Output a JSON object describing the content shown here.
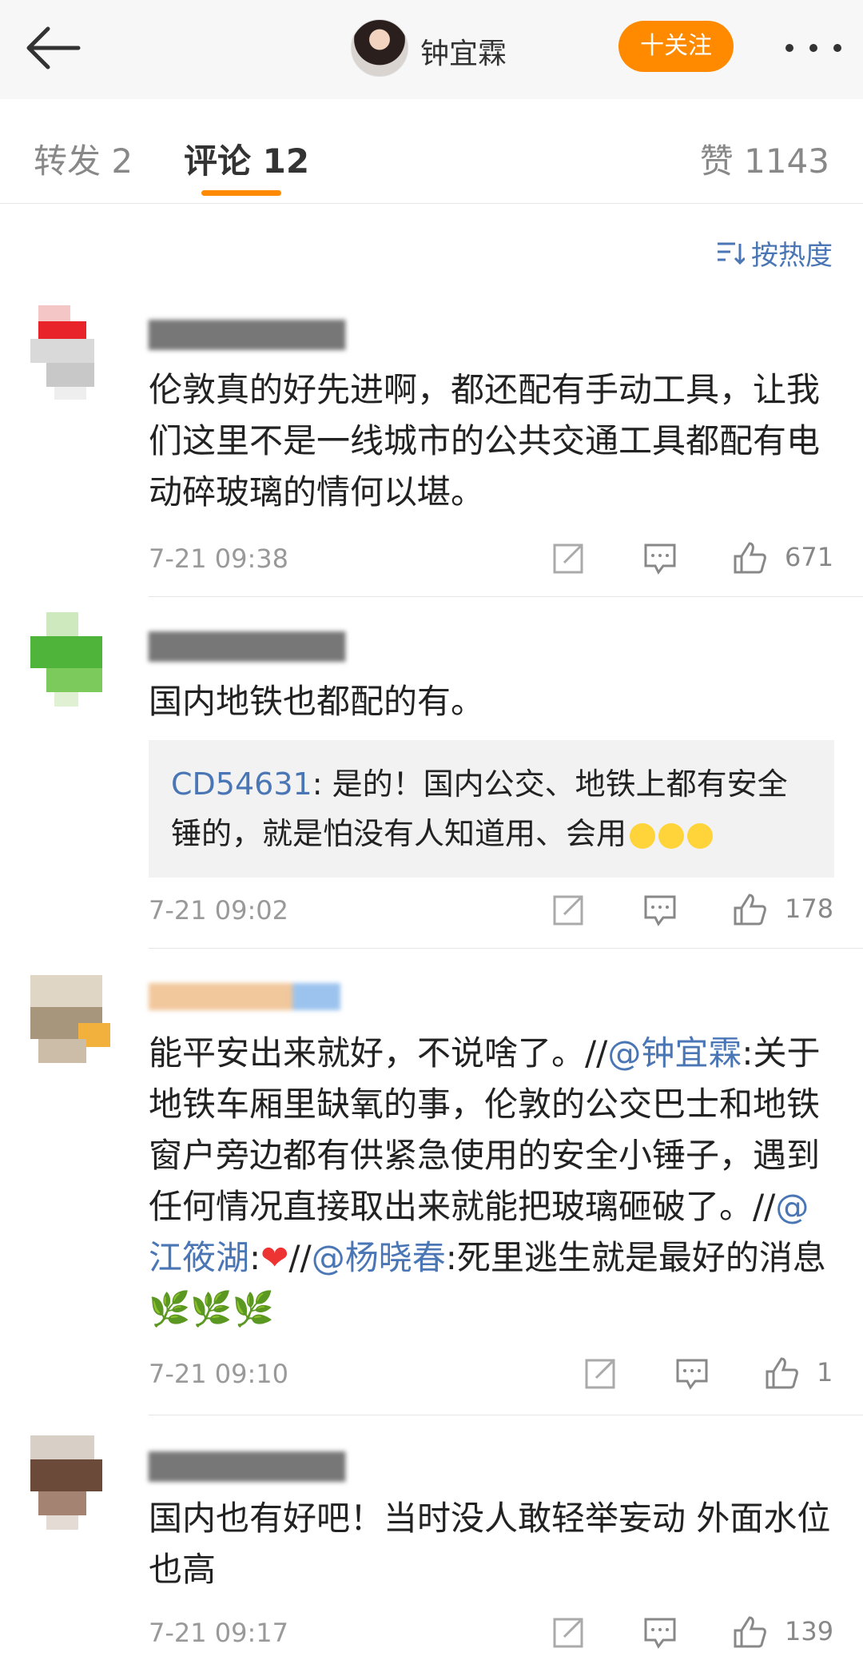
{
  "header": {
    "user_name": "钟宜霖",
    "follow_label": "十关注"
  },
  "tabs": {
    "repost": "转发 2",
    "comment": "评论 12",
    "like": "赞 1143"
  },
  "sort_label": "按热度",
  "comments": [
    {
      "text": "伦敦真的好先进啊，都还配有手动工具，让我们这里不是一线城市的公共交通工具都配有电动碎玻璃的情何以堪。",
      "time": "7-21 09:38",
      "likes": "671"
    },
    {
      "text": "国内地铁也都配的有。",
      "reply_user": "CD54631",
      "reply_text": ": 是的！国内公交、地铁上都有安全锤的，就是怕没有人知道用、会用",
      "time": "7-21 09:02",
      "likes": "178"
    },
    {
      "text_prefix": "能平安出来就好，不说啥了。//",
      "mention1": "@钟宜霖",
      "text_mid1": ":关于地铁车厢里缺氧的事，伦敦的公交巴士和地铁窗户旁边都有供紧急使用的安全小锤子，遇到任何情况直接取出来就能把玻璃砸破了。//",
      "mention2": "@江筱湖",
      "text_mid2": ":",
      "heart": "❤",
      "text_mid3": "//",
      "mention3": "@杨晓春",
      "text_mid4": ":死里逃生就是最好的消息",
      "time": "7-21 09:10",
      "likes": "1"
    },
    {
      "text": "国内也有好吧！当时没人敢轻举妄动 外面水位也高",
      "time": "7-21 09:17",
      "likes": "139"
    }
  ],
  "colors": {
    "accent": "#ff8a00",
    "link": "#4a76b5"
  }
}
